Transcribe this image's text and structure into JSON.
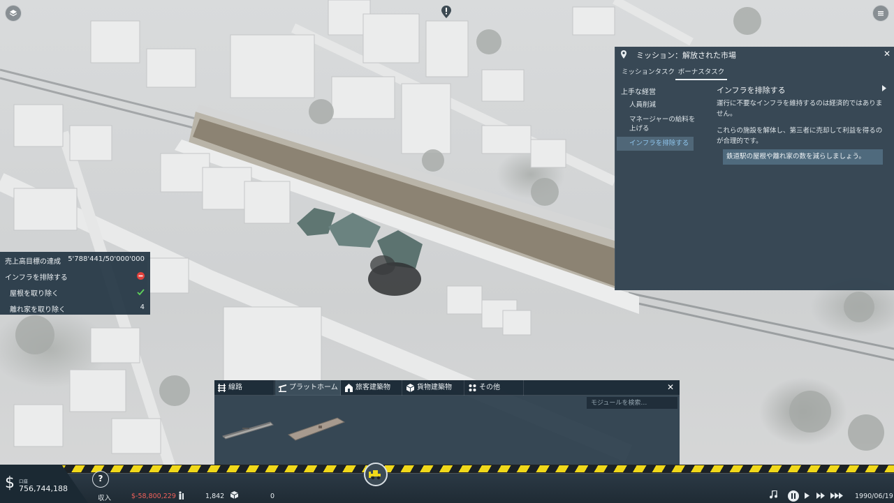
{
  "mission": {
    "title": "ミッション：解放された市場",
    "tabs": [
      {
        "label": "ミッションタスク"
      },
      {
        "label": "ボーナスタスク"
      }
    ],
    "task_group": "上手な経営",
    "tasks": [
      {
        "label": "人員削減"
      },
      {
        "label": "マネージャーの給料を上げる"
      },
      {
        "label": "インフラを排除する"
      }
    ],
    "detail": {
      "title": "インフラを排除する",
      "p1": "運行に不要なインフラを維持するのは経済的ではありません。",
      "p2": "これらの施設を解体し、第三者に売却して利益を得るのが合理的です。",
      "highlight": "鉄道駅の屋根や離れ家の数を減らしましょう。"
    }
  },
  "goals": [
    {
      "label": "売上高目標の達成",
      "value": "5'788'441/50'000'000"
    },
    {
      "label": "インフラを排除する",
      "status": "blocked"
    },
    {
      "label": "屋根を取り除く",
      "status": "done"
    },
    {
      "label": "離れ家を取り除く",
      "value": "4"
    }
  ],
  "build": {
    "tabs": [
      {
        "label": "線路",
        "icon": "track-icon"
      },
      {
        "label": "プラットホーム",
        "icon": "platform-icon"
      },
      {
        "label": "旅客建築物",
        "icon": "passenger-building-icon"
      },
      {
        "label": "貨物建築物",
        "icon": "cargo-building-icon"
      },
      {
        "label": "その他",
        "icon": "other-icon"
      }
    ],
    "search_placeholder": "モジュールを検索…"
  },
  "bottom": {
    "account_label": "口座",
    "account_value": "756,744,188",
    "income_label": "収入",
    "income_value": "$-58,800,229",
    "passengers_value": "1,842",
    "cargo_value": "0",
    "date": "1990/06/19"
  },
  "colors": {
    "panel": "#2a3c4a",
    "accent_selected": "#8fc6ee",
    "negative": "#f0605a",
    "ok": "#5fd35a",
    "blocked": "#e0413c",
    "hazard_yellow": "#f0d81a"
  }
}
